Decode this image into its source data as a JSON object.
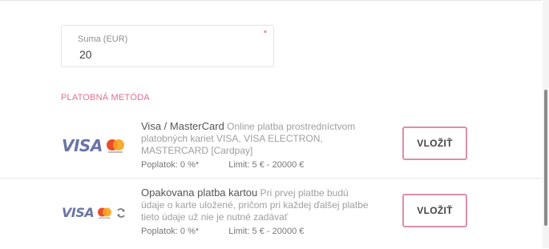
{
  "amount": {
    "label": "Suma (EUR)",
    "value": "20",
    "required_mark": "*"
  },
  "section_title": "PLATOBNÁ METÓDA",
  "methods": [
    {
      "logo_text": "VISA",
      "title": "Visa / MasterCard",
      "description": "Online platba prostredníctvom platobných kariet VISA, VISA ELECTRON, MASTERCARD [Cardpay]",
      "fee": "Poplatok: 0 %*",
      "limit": "Limit: 5 € - 20000 €",
      "button": "VLOŽIŤ"
    },
    {
      "logo_text": "VISA",
      "title": "Opakovana platba kartou",
      "description": "Pri prvej platbe budú údaje o karte uložené, pričom pri každej ďalšej platbe tieto údaje už nie je nutné zadávať",
      "fee": "Poplatok: 0 %*",
      "limit": "Limit: 5 € - 20000 €",
      "button": "VLOŽIŤ"
    }
  ],
  "colors": {
    "accent": "#dc90a6",
    "section": "#e0708f",
    "visa": "#6a75a4"
  },
  "icons": [
    "visa-logo",
    "mastercard-logo",
    "recurring-icon"
  ]
}
